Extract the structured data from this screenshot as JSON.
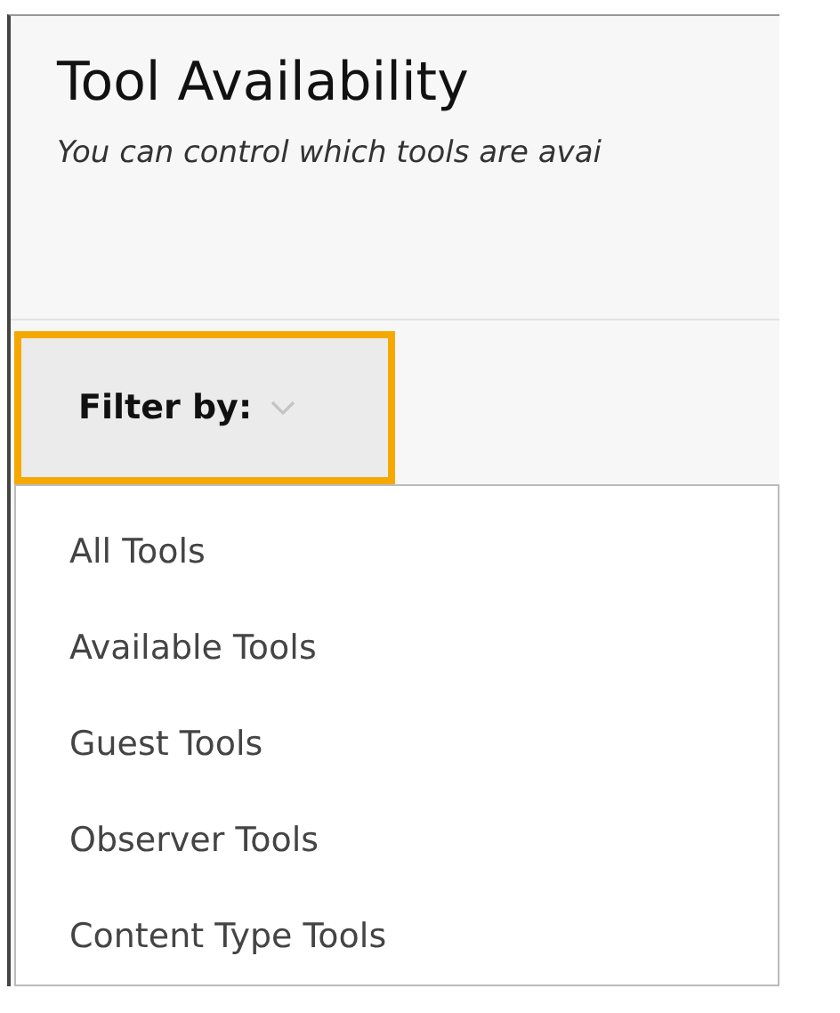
{
  "page": {
    "title": "Tool Availability",
    "description": "You can control which tools are avai"
  },
  "filter": {
    "label": "Filter by:",
    "expanded": true
  },
  "menu": [
    {
      "label": "All Tools"
    },
    {
      "label": "Available Tools"
    },
    {
      "label": "Guest Tools"
    },
    {
      "label": "Observer Tools"
    },
    {
      "label": "Content Type Tools"
    }
  ]
}
